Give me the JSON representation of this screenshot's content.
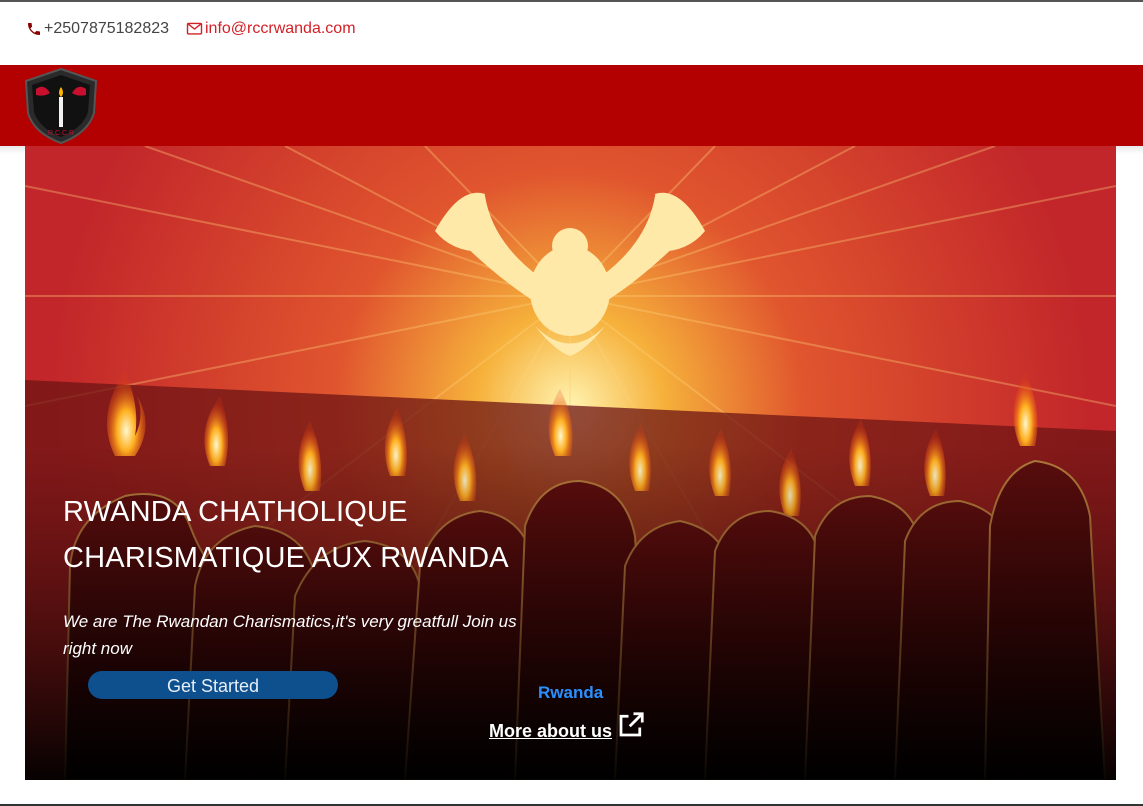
{
  "topbar": {
    "phone": "+2507875182823",
    "email": "info@rccrwanda.com",
    "phone_icon": "phone-icon",
    "email_icon": "envelope-icon"
  },
  "header": {
    "logo_icon": "shield-logo-icon",
    "logo_text": "R.C.C.R",
    "bar_color": "#b30000"
  },
  "hero": {
    "title_line1": "RWANDA CHATHOLIQUE",
    "title_line2": "CHARISMATIQUE AUX RWANDA",
    "subtitle": "We are The Rwandan Charismatics,it's very greatfull Join us right now",
    "cta_label": "Get Started",
    "country_label": "Rwanda",
    "more_label": "More about us",
    "more_icon": "external-link-icon",
    "image_icon": "dove-pentecost-image"
  },
  "colors": {
    "accent_red": "#d22027",
    "cta_blue": "#0e4f8e",
    "link_blue": "#2b90ff"
  }
}
